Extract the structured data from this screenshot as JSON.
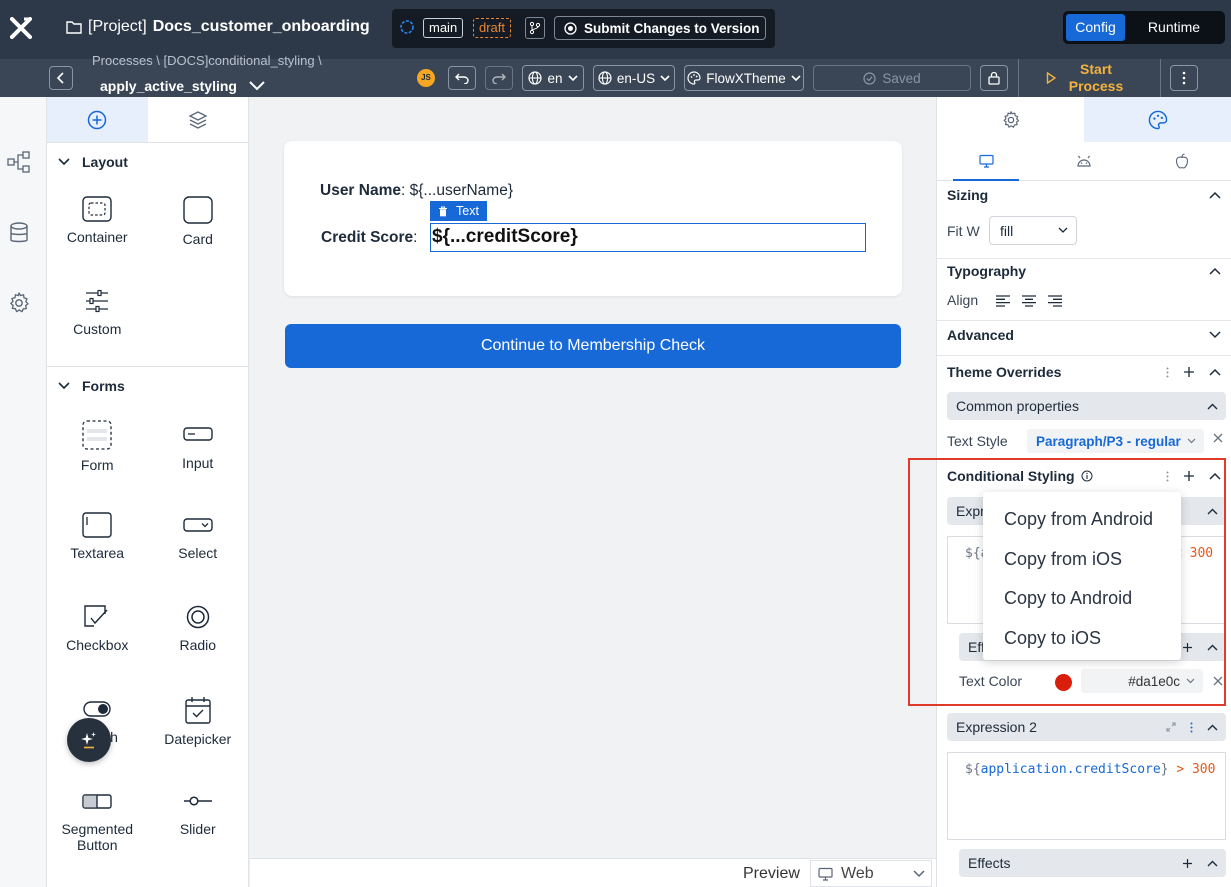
{
  "header": {
    "project_prefix": "[Project]",
    "project_name": "Docs_customer_onboarding",
    "branch": "main",
    "draft": "draft",
    "submit_label": "Submit Changes to Version",
    "mode_config": "Config",
    "mode_runtime": "Runtime"
  },
  "subbar": {
    "breadcrumb": "Processes  \\  [DOCS]conditional_styling  \\",
    "process_name": "apply_active_styling",
    "user_initials": "JS",
    "language": "en",
    "locale": "en-US",
    "theme": "FlowXTheme",
    "saved": "Saved",
    "start_process": "Start Process"
  },
  "palette": {
    "sections": [
      {
        "title": "Layout",
        "items": [
          {
            "label": "Container",
            "icon": "container-icon"
          },
          {
            "label": "Card",
            "icon": "card-icon"
          },
          {
            "label": "Custom",
            "icon": "custom-sliders-icon"
          }
        ]
      },
      {
        "title": "Forms",
        "items": [
          {
            "label": "Form",
            "icon": "form-icon"
          },
          {
            "label": "Input",
            "icon": "input-icon"
          },
          {
            "label": "Textarea",
            "icon": "textarea-icon"
          },
          {
            "label": "Select",
            "icon": "select-icon"
          },
          {
            "label": "Checkbox",
            "icon": "checkbox-icon"
          },
          {
            "label": "Radio",
            "icon": "radio-icon"
          },
          {
            "label": "Switch",
            "icon": "switch-icon"
          },
          {
            "label": "Datepicker",
            "icon": "datepicker-icon"
          },
          {
            "label": "Segmented Button",
            "icon": "segmented-button-icon"
          },
          {
            "label": "Slider",
            "icon": "slider-icon"
          }
        ]
      }
    ]
  },
  "canvas": {
    "user_label": "User Name",
    "user_value": "${...userName}",
    "credit_label": "Credit Score",
    "credit_value": "${...creditScore}",
    "text_tag": "Text",
    "continue_button": "Continue to Membership Check",
    "preview_label": "Preview",
    "platform": "Web"
  },
  "props": {
    "sizing": {
      "title": "Sizing",
      "fit_label": "Fit W",
      "fit_value": "fill"
    },
    "typography": {
      "title": "Typography",
      "align_label": "Align"
    },
    "advanced": {
      "title": "Advanced"
    },
    "theme_overrides": {
      "title": "Theme Overrides",
      "common": "Common properties",
      "text_style_label": "Text Style",
      "text_style_value": "Paragraph/P3 - regular"
    },
    "conditional": {
      "title": "Conditional Styling",
      "expr1_title": "Expr",
      "expr1_code_start": "${a",
      "expr1_code_end": "< 300",
      "effects_title": "Eff",
      "text_color_label": "Text Color",
      "text_color_value": "#da1e0c",
      "text_color_hex": "#da1e0c",
      "expr2_title": "Expression 2",
      "expr2_code_var": "application.creditScore",
      "expr2_code_op": "> 300",
      "effects2_title": "Effects"
    }
  },
  "context_menu": {
    "items": [
      "Copy from Android",
      "Copy from iOS",
      "Copy to Android",
      "Copy to iOS"
    ]
  }
}
